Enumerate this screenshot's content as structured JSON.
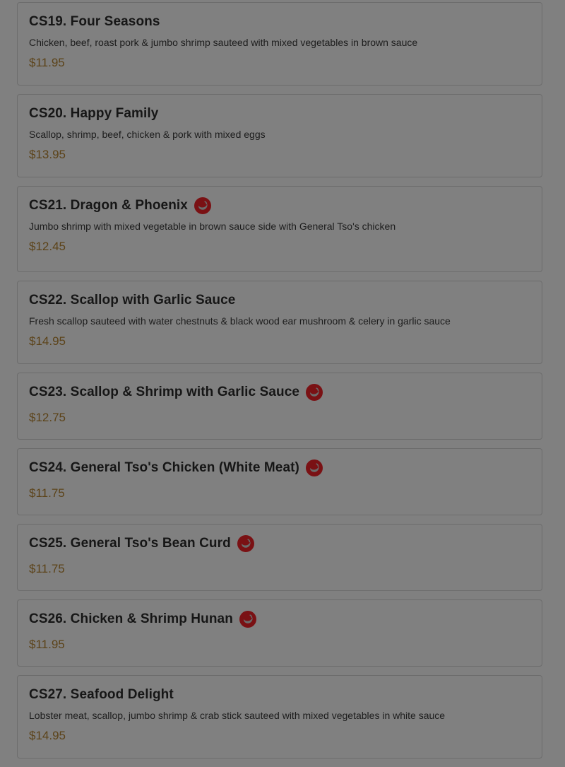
{
  "menu": {
    "items": [
      {
        "title": "CS19. Four Seasons",
        "description": "Chicken, beef, roast pork & jumbo shrimp sauteed with mixed vegetables in brown sauce",
        "price": "$11.95",
        "spicy": false
      },
      {
        "title": "CS20. Happy Family",
        "description": "Scallop, shrimp, beef, chicken & pork with mixed eggs",
        "price": "$13.95",
        "spicy": false
      },
      {
        "title": "CS21. Dragon & Phoenix",
        "description": "Jumbo shrimp with mixed vegetable in brown sauce side with General Tso's chicken",
        "price": "$12.45",
        "spicy": true,
        "icon": "hot-pepper-icon"
      },
      {
        "title": "CS22. Scallop with Garlic Sauce",
        "description": "Fresh scallop sauteed with water chestnuts & black wood ear mushroom & celery in garlic sauce",
        "price": "$14.95",
        "spicy": false
      },
      {
        "title": "CS23. Scallop & Shrimp with Garlic Sauce",
        "description": "",
        "price": "$12.75",
        "spicy": true,
        "icon": "hot-pepper-icon"
      },
      {
        "title": "CS24. General Tso's Chicken (White Meat)",
        "description": "",
        "price": "$11.75",
        "spicy": true,
        "icon": "hot-pepper-icon"
      },
      {
        "title": "CS25. General Tso's Bean Curd",
        "description": "",
        "price": "$11.75",
        "spicy": true,
        "icon": "hot-pepper-icon"
      },
      {
        "title": "CS26. Chicken & Shrimp Hunan",
        "description": "",
        "price": "$11.95",
        "spicy": true,
        "icon": "hot-pepper-icon"
      },
      {
        "title": "CS27. Seafood Delight",
        "description": "Lobster meat, scallop, jumbo shrimp & crab stick sauteed with mixed vegetables in white sauce",
        "price": "$14.95",
        "spicy": false
      }
    ]
  },
  "colors": {
    "overlay_background": "#808080",
    "title_text": "#161616",
    "price_text": "#5c4319",
    "spicy_badge": "#7a1114"
  }
}
